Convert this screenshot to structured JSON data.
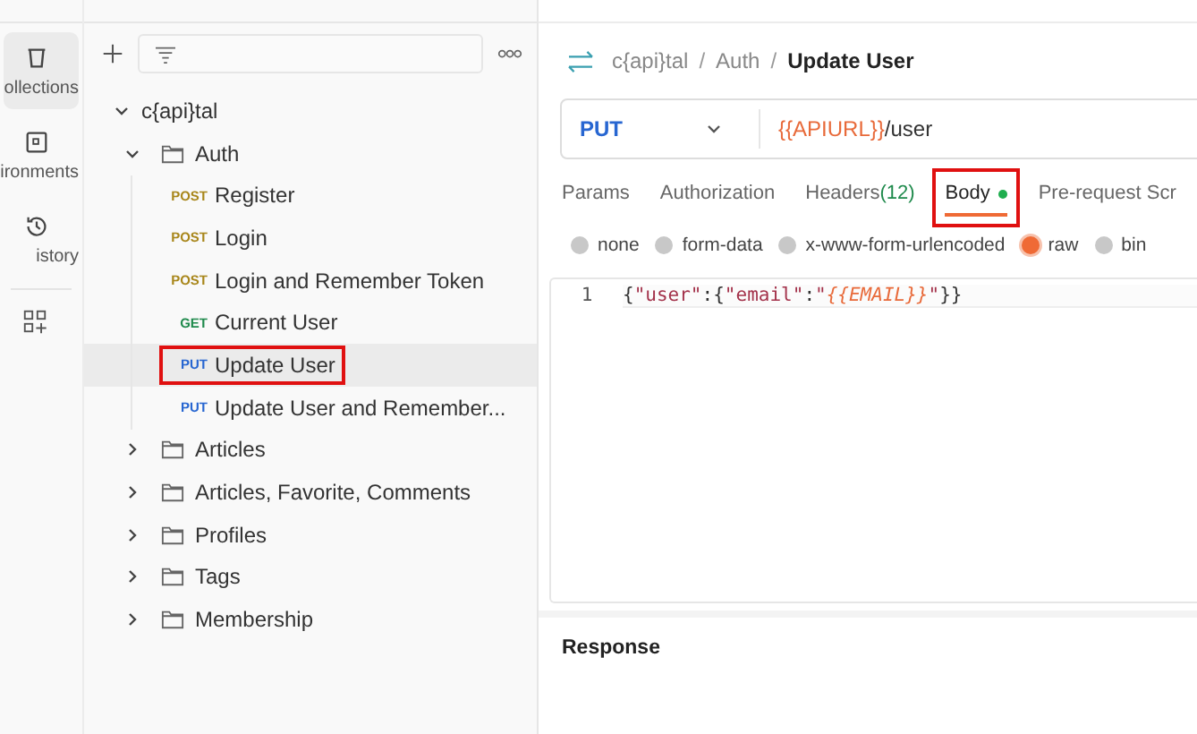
{
  "nav_rail": {
    "items": [
      {
        "label": "ollections",
        "selected": true
      },
      {
        "label": "ironments",
        "selected": false
      },
      {
        "label": "istory",
        "selected": false
      }
    ]
  },
  "sidebar": {
    "tree": [
      {
        "label": "c{api}tal",
        "kind": "collection",
        "expanded": true,
        "children": [
          {
            "label": "Auth",
            "kind": "folder",
            "expanded": true,
            "children": [
              {
                "label": "Register",
                "kind": "request",
                "method": {
                  "text": "POST",
                  "kind": "post"
                },
                "selected": false,
                "highlighted": false
              },
              {
                "label": "Login",
                "kind": "request",
                "method": {
                  "text": "POST",
                  "kind": "post"
                },
                "selected": false,
                "highlighted": false
              },
              {
                "label": "Login and Remember Token",
                "kind": "request",
                "method": {
                  "text": "POST",
                  "kind": "post"
                },
                "selected": false,
                "highlighted": false
              },
              {
                "label": "Current User",
                "kind": "request",
                "method": {
                  "text": "GET",
                  "kind": "get"
                },
                "selected": false,
                "highlighted": false
              },
              {
                "label": "Update User",
                "kind": "request",
                "method": {
                  "text": "PUT",
                  "kind": "put"
                },
                "selected": true,
                "highlighted": true
              },
              {
                "label": "Update User and Remember...",
                "kind": "request",
                "method": {
                  "text": "PUT",
                  "kind": "put"
                },
                "selected": false,
                "highlighted": false
              }
            ]
          },
          {
            "label": "Articles",
            "kind": "folder",
            "expanded": false
          },
          {
            "label": "Articles, Favorite, Comments",
            "kind": "folder",
            "expanded": false
          },
          {
            "label": "Profiles",
            "kind": "folder",
            "expanded": false
          },
          {
            "label": "Tags",
            "kind": "folder",
            "expanded": false
          },
          {
            "label": "Membership",
            "kind": "folder",
            "expanded": false
          }
        ]
      }
    ]
  },
  "request": {
    "breadcrumb": [
      {
        "kind": "link",
        "text": "c{api}tal"
      },
      {
        "kind": "separator",
        "text": "/"
      },
      {
        "kind": "link",
        "text": "Auth"
      },
      {
        "kind": "separator",
        "text": "/"
      },
      {
        "kind": "current",
        "text": "Update User"
      }
    ],
    "method": "PUT",
    "url": [
      {
        "kind": "variable",
        "text": "{{APIURL}}"
      },
      {
        "kind": "plain",
        "text": "/user"
      }
    ],
    "tabs": [
      {
        "label": "Params",
        "selected": false,
        "highlighted": false
      },
      {
        "label": "Authorization",
        "selected": false,
        "highlighted": false
      },
      {
        "label": "Headers",
        "count": "(12)",
        "selected": false,
        "highlighted": false
      },
      {
        "label": "Body",
        "has_content": true,
        "selected": true,
        "highlighted": true
      },
      {
        "label": "Pre-request Scr",
        "selected": false,
        "highlighted": false
      }
    ],
    "body_types": [
      {
        "label": "none",
        "selected": false
      },
      {
        "label": "form-data",
        "selected": false
      },
      {
        "label": "x-www-form-urlencoded",
        "selected": false
      },
      {
        "label": "raw",
        "selected": true
      },
      {
        "label": "bin",
        "selected": false
      }
    ],
    "code_lines": [
      {
        "number": "1",
        "tokens": [
          {
            "kind": "punct",
            "text": "{"
          },
          {
            "kind": "string",
            "text": "\"user\""
          },
          {
            "kind": "punct",
            "text": ":{"
          },
          {
            "kind": "string",
            "text": "\"email\""
          },
          {
            "kind": "punct",
            "text": ":"
          },
          {
            "kind": "string",
            "text": "\""
          },
          {
            "kind": "variable",
            "text": "{{EMAIL}}"
          },
          {
            "kind": "string",
            "text": "\""
          },
          {
            "kind": "punct",
            "text": "}}"
          }
        ]
      }
    ]
  },
  "response": {
    "title": "Response"
  }
}
